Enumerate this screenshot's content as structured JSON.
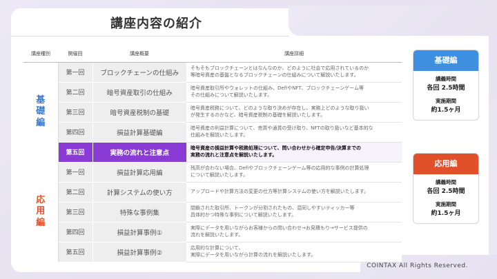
{
  "title": "講座内容の紹介",
  "table": {
    "headers": {
      "type": "講座種別",
      "session": "開催回",
      "summary": "講座概要",
      "detail": "講座詳細"
    },
    "groups": {
      "basic": "基礎編",
      "applied": "応用編"
    },
    "rows": [
      {
        "session": "第一回",
        "summary": "ブロックチェーンの仕組み",
        "detail": [
          "そもそもブロックチェーンとはなんなのか、どのように社会で応用されているのか",
          "等暗号資産の基盤となるブロックチェーンの仕組みについて解説いたします。"
        ]
      },
      {
        "session": "第二回",
        "summary": "暗号資産取引の仕組み",
        "detail": [
          "暗号資産取引所やウォレットの仕組み、DefiやNFT、ブロックチェーンゲーム等",
          "その仕組みについて解説いたします。"
        ]
      },
      {
        "session": "第三回",
        "summary": "暗号資産税制の基礎",
        "detail": [
          "暗号資産税務について、どのような取り決めが存在し、実務上どのような取り扱い",
          "が発生するのかなど、暗号資産税制の基礎を解説いたします。"
        ]
      },
      {
        "session": "第四回",
        "summary": "損益計算基礎編",
        "detail": [
          "暗号資産の利益計算について、売買や通貨の受け取り、NFTの取り扱いなど基本的な",
          "仕組みを解説いたします。"
        ]
      },
      {
        "session": "第五回",
        "summary": "実務の流れと注意点",
        "detail": [
          "暗号資産の損益計算や税務処理について、問い合わせから確定申告/決算までの",
          "実務の流れと注意点を解説いたします。"
        ]
      },
      {
        "session": "第一回",
        "summary": "損益計算応用編",
        "detail": [
          "残高が合わない場合、Defiやブロックチェーンゲーム等の応用的な事例の計算処理",
          "について解説いたします。"
        ]
      },
      {
        "session": "第二回",
        "summary": "計算システムの使い方",
        "detail": [
          "アップロードや計算方法の変更の仕方等計算システムの使い方を解説いたします。"
        ]
      },
      {
        "session": "第三回",
        "summary": "特殊な事例集",
        "detail": [
          "閉鎖された取引所、トークンが分割されたもの、混同しやすいティッカー等",
          "具体的かつ特殊な事例について解説いたします。"
        ]
      },
      {
        "session": "第四回",
        "summary": "損益計算事例①",
        "detail": [
          "実際にデータを用いながらお客様からの問い合わせ→お見積もり→サービス提供の",
          "流れを解説いたします。"
        ]
      },
      {
        "session": "第五回",
        "summary": "損益計算事例②",
        "detail": [
          "応用的な計算について、",
          "実際にデータを用いながら計算の流れを解説いたします。"
        ]
      }
    ]
  },
  "cards": [
    {
      "title": "基礎編",
      "color": "#3f8fe0",
      "hours_label": "講義時間",
      "hours_value": "各回 2.5時間",
      "period_label": "実施期間",
      "period_value": "約1.5ヶ月"
    },
    {
      "title": "応用編",
      "color": "#e0502a",
      "hours_label": "講義時間",
      "hours_value": "各回 2.5時間",
      "period_label": "実施期間",
      "period_value": "約1.5ヶ月"
    }
  ],
  "footer": "COINTAX All Rights Reserved."
}
